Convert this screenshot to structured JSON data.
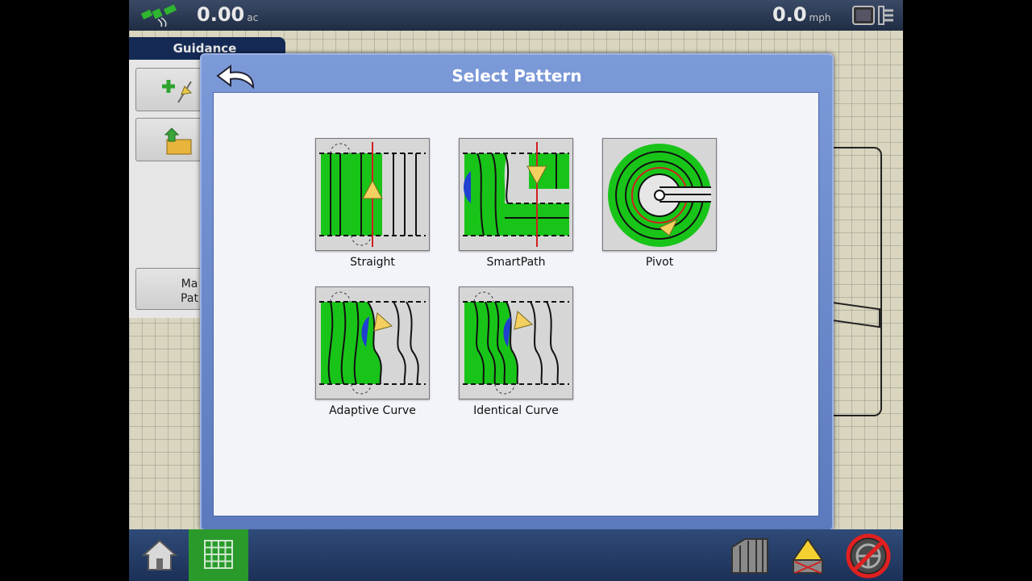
{
  "topbar": {
    "area_value": "0.00",
    "area_unit": "ac",
    "speed_value": "0.0",
    "speed_unit": "mph"
  },
  "guidance_panel": {
    "tab_label": "Guidance",
    "manage_btn_line1": "Ma",
    "manage_btn_line2": "Pat"
  },
  "dialog": {
    "title": "Select Pattern",
    "patterns": [
      {
        "label": "Straight"
      },
      {
        "label": "SmartPath"
      },
      {
        "label": "Pivot"
      },
      {
        "label": "Adaptive Curve"
      },
      {
        "label": "Identical Curve"
      }
    ]
  },
  "colors": {
    "accent_green": "#19c419",
    "title_bar_blue": "#5f7dc2",
    "map_button_green": "#2a9a2a"
  },
  "icons": [
    "gps-icon",
    "screen-toggle-icon",
    "add-guidance-icon",
    "load-folder-icon",
    "back-arrow-icon",
    "home-icon",
    "map-grid-icon",
    "implement-icon",
    "warning-icon",
    "steering-disabled-icon"
  ]
}
